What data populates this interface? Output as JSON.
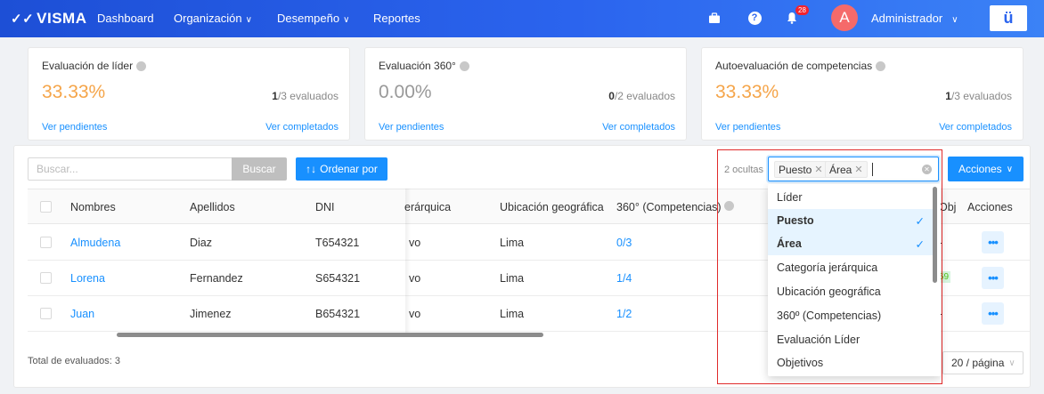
{
  "nav": {
    "brand": "VISMA",
    "items": [
      {
        "label": "Dashboard",
        "has_menu": false
      },
      {
        "label": "Organización",
        "has_menu": true
      },
      {
        "label": "Desempeño",
        "has_menu": true
      },
      {
        "label": "Reportes",
        "has_menu": false
      }
    ],
    "notification_count": "28",
    "avatar_initial": "A",
    "user_name": "Administrador",
    "logo_text": "ü",
    "icons": [
      "briefcase-icon",
      "help-icon",
      "bell-icon",
      "chevron-down-icon"
    ],
    "gradient_colors": [
      "#1d4fd6",
      "#3b82f6"
    ]
  },
  "cards": [
    {
      "title": "Evaluación de líder",
      "percent": "33.33%",
      "count": "1",
      "count_suffix": "/3 evaluados",
      "link_pending": "Ver pendientes",
      "link_done": "Ver completados",
      "percent_color": "#f5a54a"
    },
    {
      "title": "Evaluación 360°",
      "percent": "0.00%",
      "count": "0",
      "count_suffix": "/2 evaluados",
      "link_pending": "Ver pendientes",
      "link_done": "Ver completados",
      "percent_color": "#999999"
    },
    {
      "title": "Autoevaluación de competencias",
      "percent": "33.33%",
      "count": "1",
      "count_suffix": "/3 evaluados",
      "link_pending": "Ver pendientes",
      "link_done": "Ver completados",
      "percent_color": "#f5a54a"
    }
  ],
  "toolbar": {
    "search_placeholder": "Buscar...",
    "search_button": "Buscar",
    "sort_button": "Ordenar por",
    "hidden_count": "2 ocultas",
    "selected_chips": [
      "Puesto",
      "Área"
    ],
    "actions_button": "Acciones"
  },
  "table": {
    "headers": {
      "nombres": "Nombres",
      "apellidos": "Apellidos",
      "dni": "DNI",
      "jerarquica": "erárquica",
      "ubicacion": "Ubicación geográfica",
      "competencias": "360° (Competencias)",
      "obj": "Obj",
      "acciones": "Acciones"
    },
    "rows": [
      {
        "nombre": "Almudena",
        "apellido": "Diaz",
        "dni": "T654321",
        "jerarquica": "vo",
        "ubicacion": "Lima",
        "competencias": "0/3",
        "obj": "-"
      },
      {
        "nombre": "Lorena",
        "apellido": "Fernandez",
        "dni": "S654321",
        "jerarquica": "vo",
        "ubicacion": "Lima",
        "competencias": "1/4",
        "obj": "69"
      },
      {
        "nombre": "Juan",
        "apellido": "Jimenez",
        "dni": "B654321",
        "jerarquica": "vo",
        "ubicacion": "Lima",
        "competencias": "1/2",
        "obj": "-"
      }
    ],
    "total_label": "Total de evaluados: 3",
    "page_size": "20 / página"
  },
  "column_options": [
    {
      "label": "Líder",
      "selected": false
    },
    {
      "label": "Puesto",
      "selected": true
    },
    {
      "label": "Área",
      "selected": true
    },
    {
      "label": "Categoría jerárquica",
      "selected": false
    },
    {
      "label": "Ubicación geográfica",
      "selected": false
    },
    {
      "label": "360º (Competencias)",
      "selected": false
    },
    {
      "label": "Evaluación Líder",
      "selected": false
    },
    {
      "label": "Objetivos",
      "selected": false
    }
  ],
  "colors": {
    "primary": "#1890ff",
    "highlight_outline": "#e02b2b",
    "selected_option_bg": "#e6f4ff"
  }
}
